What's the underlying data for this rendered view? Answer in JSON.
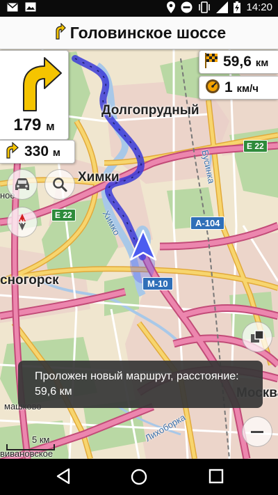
{
  "status_bar": {
    "time": "14:20",
    "icons": [
      "mail-icon",
      "image-icon",
      "location-icon",
      "do-not-disturb-icon",
      "vibrate-icon",
      "signal-icon",
      "battery-charging-icon"
    ]
  },
  "navigation": {
    "street_name": "Головинское шоссе",
    "turn_distance": "179",
    "turn_distance_unit": "м",
    "next_turn_distance": "330",
    "next_turn_distance_unit": "м",
    "remaining_distance": "59,6",
    "remaining_distance_unit": "км",
    "speed": "1",
    "speed_unit": "км/ч"
  },
  "map": {
    "labels": {
      "dolgoprudny": "Долгопрудный",
      "khimki": "Химки",
      "krasnogorsk": "сногорск",
      "moskva": "Москва",
      "mashkovo": "машково",
      "ivanovskoe": "вивановское",
      "no": "ное",
      "km5": "5 км",
      "khimki_river": "Химко",
      "bychikha": "Бусинка",
      "likhoborka": "Лихоборка"
    },
    "shields": {
      "e22_left": "E 22",
      "e22_right": "E 22",
      "a104": "A-104",
      "m10": "M-10"
    },
    "colors": {
      "route": "#3b3bd8",
      "motorway": "#e46a9a",
      "trunk": "#f3c34c",
      "water": "#a8c8e8",
      "forest": "#b9d8a4"
    }
  },
  "toast": {
    "message": "Проложен новый маршрут, расстояние: 59,6 км"
  }
}
